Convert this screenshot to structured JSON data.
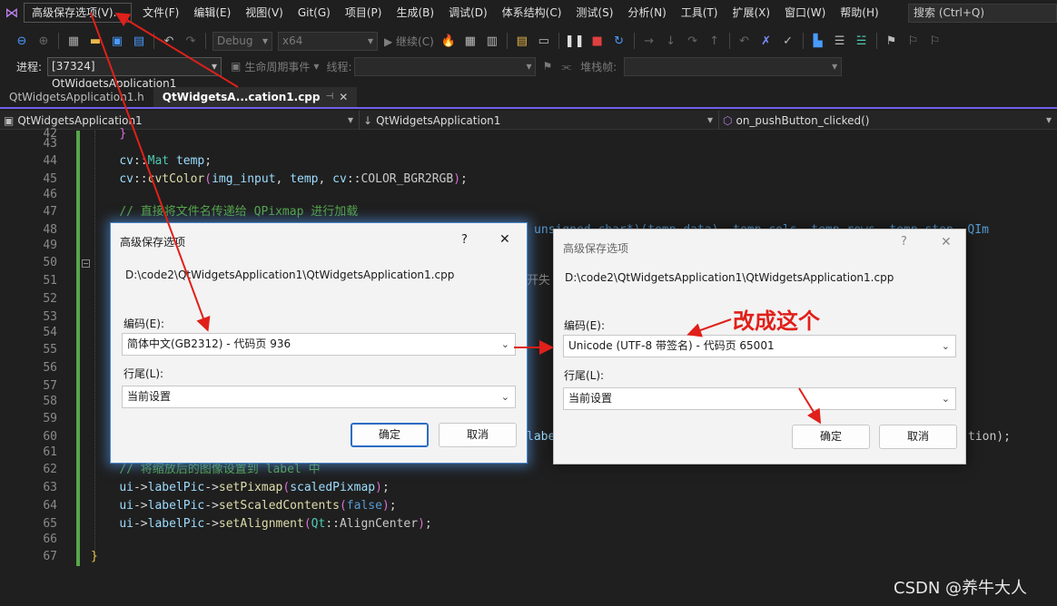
{
  "menubar": {
    "items": [
      "高级保存选项(V)...",
      "文件(F)",
      "编辑(E)",
      "视图(V)",
      "Git(G)",
      "项目(P)",
      "生成(B)",
      "调试(D)",
      "体系结构(C)",
      "测试(S)",
      "分析(N)",
      "工具(T)",
      "扩展(X)",
      "窗口(W)",
      "帮助(H)"
    ],
    "search_label": "搜索 (Ctrl+Q)"
  },
  "toolbar": {
    "config": "Debug",
    "platform": "x64",
    "continue_label": "▶ 继续(C)"
  },
  "process_bar": {
    "process_label": "进程:",
    "process_value": "[37324] QtWidgetsApplication1",
    "lifecycle_label": "生命周期事件",
    "thread_label": "线程:",
    "stackframe_label": "堆栈帧:"
  },
  "tabs": {
    "tab1": "QtWidgetsApplication1.h",
    "tab2": "QtWidgetsA...cation1.cpp"
  },
  "navbar": {
    "project": "QtWidgetsApplication1",
    "scope": "QtWidgetsApplication1",
    "member": "on_pushButton_clicked()"
  },
  "editor": {
    "line_numbers": [
      "42",
      "43",
      "44",
      "45",
      "46",
      "47",
      "48",
      "49",
      "50",
      "51",
      "52",
      "53",
      "54",
      "55",
      "56",
      "57",
      "58",
      "59",
      "60",
      "61",
      "62",
      "63",
      "64",
      "65",
      "66",
      "67"
    ],
    "fragments": {
      "l48_tail": "unsigned char*)(temp.data), temp.cols, temp.rows, temp.step, QIm",
      "l51_tail": "开失",
      "l60_tail_a": "labe",
      "l60_tail_b": "tion);"
    }
  },
  "dialog_left": {
    "title": "高级保存选项",
    "help": "?",
    "close": "✕",
    "path": "D:\\code2\\QtWidgetsApplication1\\QtWidgetsApplication1.cpp",
    "encoding_label": "编码(E):",
    "encoding_value": "简体中文(GB2312) - 代码页 936",
    "lineend_label": "行尾(L):",
    "lineend_value": "当前设置",
    "ok": "确定",
    "cancel": "取消"
  },
  "dialog_right": {
    "title": "高级保存选项",
    "help": "?",
    "close": "✕",
    "path": "D:\\code2\\QtWidgetsApplication1\\QtWidgetsApplication1.cpp",
    "encoding_label": "编码(E):",
    "encoding_value": "Unicode (UTF-8 带签名) - 代码页 65001",
    "lineend_label": "行尾(L):",
    "lineend_value": "当前设置",
    "ok": "确定",
    "cancel": "取消"
  },
  "annotation": "改成这个",
  "watermark": "CSDN @养牛大人",
  "colors": {
    "accent": "#7160e8",
    "arrow": "#e0201a",
    "change_bar": "#57a64a"
  }
}
